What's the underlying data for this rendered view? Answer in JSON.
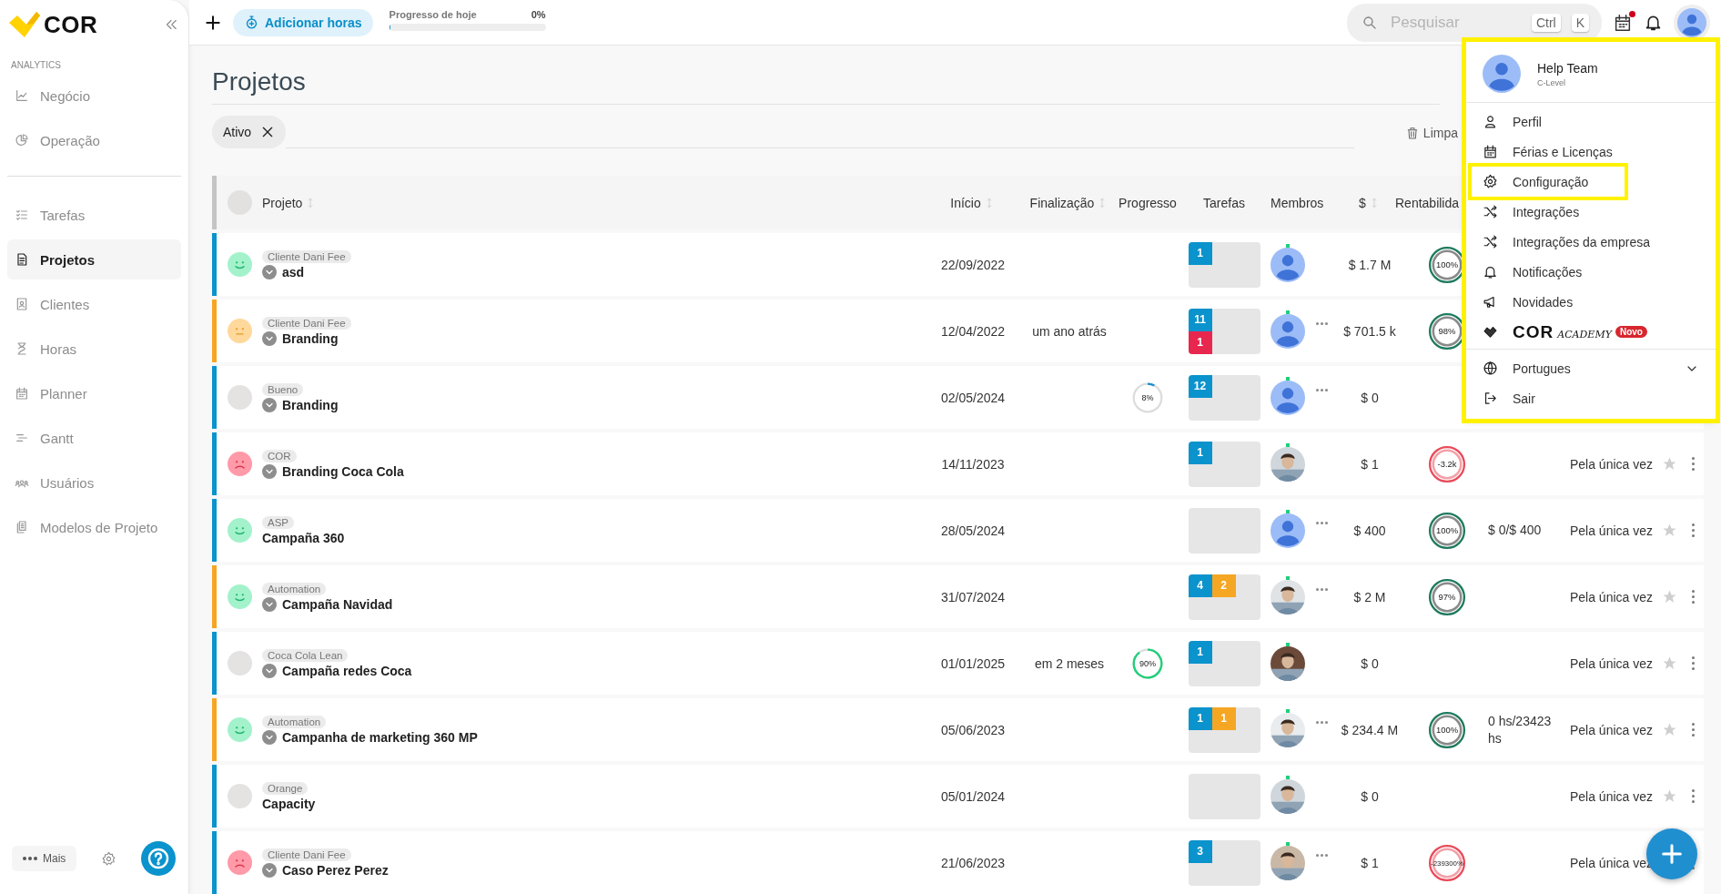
{
  "sidebar": {
    "logo": "COR",
    "section": "ANALYTICS",
    "analytics_items": [
      {
        "label": "Negócio",
        "selected": false
      },
      {
        "label": "Operação",
        "selected": false
      }
    ],
    "items": [
      {
        "label": "Tarefas",
        "selected": false
      },
      {
        "label": "Projetos",
        "selected": true
      },
      {
        "label": "Clientes",
        "selected": false
      },
      {
        "label": "Horas",
        "selected": false
      },
      {
        "label": "Planner",
        "selected": false
      },
      {
        "label": "Gantt",
        "selected": false
      },
      {
        "label": "Usuários",
        "selected": false
      },
      {
        "label": "Modelos de Projeto",
        "selected": false
      }
    ],
    "more_button": "Mais"
  },
  "topbar": {
    "add_hours": "Adicionar horas",
    "progress_label": "Progresso de hoje",
    "progress_value": "0%",
    "progress": {
      "level": 0
    },
    "search": {
      "placeholder": "Pesquisar",
      "shortcut": [
        "Ctrl",
        "K"
      ]
    },
    "calendar_alert": true
  },
  "page": {
    "title": "Projetos",
    "filters": [
      {
        "label": "Ativo"
      }
    ],
    "clear_button": "Limpa"
  },
  "table": {
    "columns": [
      {
        "label": "Projeto",
        "sortable": true
      },
      {
        "label": "Início",
        "sortable": true
      },
      {
        "label": "Finalização",
        "sortable": true
      },
      {
        "label": "Progresso",
        "sortable": false
      },
      {
        "label": "Tarefas",
        "sortable": false
      },
      {
        "label": "Membros",
        "sortable": false
      },
      {
        "label": "$",
        "sortable": true
      },
      {
        "label": "Rentabilida",
        "sortable": false
      }
    ],
    "rows": [
      {
        "color": "#0a93cc",
        "mood": {
          "kind": "happy"
        },
        "client": "Cliente Dani Fee",
        "expandable": true,
        "name": "asd",
        "start": "22/09/2022",
        "tasks": {
          "kind": "row",
          "badges": [
            {
              "count": "1",
              "color": "#0a93cc"
            }
          ]
        },
        "member": {
          "kind": "default"
        },
        "extra_members": false,
        "amount": "$  1.7 M",
        "profit": {
          "text": "100%",
          "kind": "good"
        }
      },
      {
        "color": "#f5a623",
        "mood": {
          "kind": "neutral"
        },
        "client": "Cliente Dani Fee",
        "expandable": true,
        "name": "Branding",
        "start": "12/04/2022",
        "end": "um ano atrás",
        "tasks": {
          "kind": "column",
          "badges": [
            {
              "count": "11",
              "color": "#0a93cc"
            },
            {
              "count": "1",
              "color": "#e8274f"
            }
          ]
        },
        "member": {
          "kind": "default"
        },
        "extra_members": true,
        "amount": "$  701.5 k",
        "profit": {
          "text": "98%",
          "kind": "good"
        }
      },
      {
        "color": "#0a93cc",
        "mood": {
          "kind": "none"
        },
        "client": "Bueno",
        "expandable": true,
        "name": "Branding",
        "start": "02/05/2024",
        "progress": {
          "text": "8%",
          "level": 0.08,
          "color": "#1a8fd0"
        },
        "tasks": {
          "kind": "row",
          "badges": [
            {
              "count": "12",
              "color": "#0a93cc"
            }
          ]
        },
        "member": {
          "kind": "default"
        },
        "extra_members": true,
        "amount": "$  0"
      },
      {
        "color": "#0a93cc",
        "mood": {
          "kind": "sad"
        },
        "client": "COR",
        "expandable": true,
        "name": "Branding Coca Cola",
        "start": "14/11/2023",
        "tasks": {
          "kind": "row",
          "badges": [
            {
              "count": "1",
              "color": "#0a93cc"
            }
          ]
        },
        "extra_members": false,
        "amount": "$  1",
        "profit": {
          "text": "-3.2k",
          "kind": "bad"
        },
        "recurrence": "Pela única vez"
      },
      {
        "color": "#0a93cc",
        "mood": {
          "kind": "happy"
        },
        "client": "ASP",
        "expandable": false,
        "name": "Campaña 360",
        "start": "28/05/2024",
        "tasks": {
          "kind": "row"
        },
        "member": {
          "kind": "default"
        },
        "extra_members": true,
        "amount": "$  400",
        "profit": {
          "text": "100%",
          "kind": "good"
        },
        "budget": "$ 0/$ 400",
        "recurrence": "Pela única vez"
      },
      {
        "color": "#f5a623",
        "mood": {
          "kind": "happy"
        },
        "client": "Automation",
        "expandable": true,
        "name": "Campaña Navidad",
        "start": "31/07/2024",
        "tasks": {
          "kind": "row",
          "badges": [
            {
              "count": "4",
              "color": "#0a93cc"
            },
            {
              "count": "2",
              "color": "#f5a623"
            }
          ]
        },
        "extra_members": true,
        "amount": "$  2 M",
        "profit": {
          "text": "97%",
          "kind": "good"
        },
        "recurrence": "Pela única vez"
      },
      {
        "color": "#0a93cc",
        "mood": {
          "kind": "none"
        },
        "client": "Coca Cola Lean",
        "expandable": true,
        "name": "Campaña redes Coca",
        "start": "01/01/2025",
        "end": "em 2 meses",
        "progress": {
          "text": "90%",
          "level": 0.9,
          "color": "#1fcf7a"
        },
        "tasks": {
          "kind": "row",
          "badges": [
            {
              "count": "1",
              "color": "#0a93cc"
            }
          ]
        },
        "extra_members": false,
        "amount": "$  0",
        "recurrence": "Pela única vez"
      },
      {
        "color": "#f5a623",
        "mood": {
          "kind": "happy"
        },
        "client": "Automation",
        "expandable": true,
        "name": "Campanha de marketing 360 MP",
        "start": "05/06/2023",
        "tasks": {
          "kind": "row",
          "badges": [
            {
              "count": "1",
              "color": "#0a93cc"
            },
            {
              "count": "1",
              "color": "#f5a623"
            }
          ]
        },
        "extra_members": true,
        "amount": "$  234.4 M",
        "profit": {
          "text": "100%",
          "kind": "good"
        },
        "budget": "0 hs/23423 hs",
        "recurrence": "Pela única vez"
      },
      {
        "color": "#0a93cc",
        "mood": {
          "kind": "none"
        },
        "client": "Orange",
        "expandable": false,
        "name": "Capacity",
        "start": "05/01/2024",
        "tasks": {
          "kind": "row"
        },
        "extra_members": false,
        "amount": "$  0",
        "recurrence": "Pela única vez"
      },
      {
        "color": "#0a93cc",
        "mood": {
          "kind": "sad"
        },
        "client": "Cliente Dani Fee",
        "expandable": true,
        "name": "Caso Perez Perez",
        "start": "21/06/2023",
        "tasks": {
          "kind": "row",
          "badges": [
            {
              "count": "3",
              "color": "#0a93cc"
            }
          ]
        },
        "extra_members": true,
        "amount": "$  1",
        "profit": {
          "text": "-239300%",
          "kind": "bad"
        },
        "recurrence": "Pela única vez"
      }
    ]
  },
  "user_menu": {
    "name": "Help Team",
    "role": "C-Level",
    "highlighted": true,
    "items": [
      {
        "kind": "link",
        "label": "Perfil",
        "highlighted": false
      },
      {
        "kind": "link",
        "label": "Férias e Licenças",
        "highlighted": false
      },
      {
        "kind": "link",
        "label": "Configuração",
        "highlighted": true
      },
      {
        "kind": "link",
        "label": "Integrações",
        "highlighted": false
      },
      {
        "kind": "link",
        "label": "Integrações da empresa",
        "highlighted": false
      },
      {
        "kind": "link",
        "label": "Notificações",
        "highlighted": false
      },
      {
        "kind": "link",
        "label": "Novidades",
        "highlighted": false
      },
      {
        "kind": "academy",
        "label": "COR",
        "sublabel": "ACADEMY",
        "badge": "Novo",
        "highlighted": false
      },
      {
        "kind": "language",
        "label": "Portugues",
        "highlighted": false
      },
      {
        "kind": "link",
        "label": "Sair",
        "highlighted": false
      }
    ]
  }
}
